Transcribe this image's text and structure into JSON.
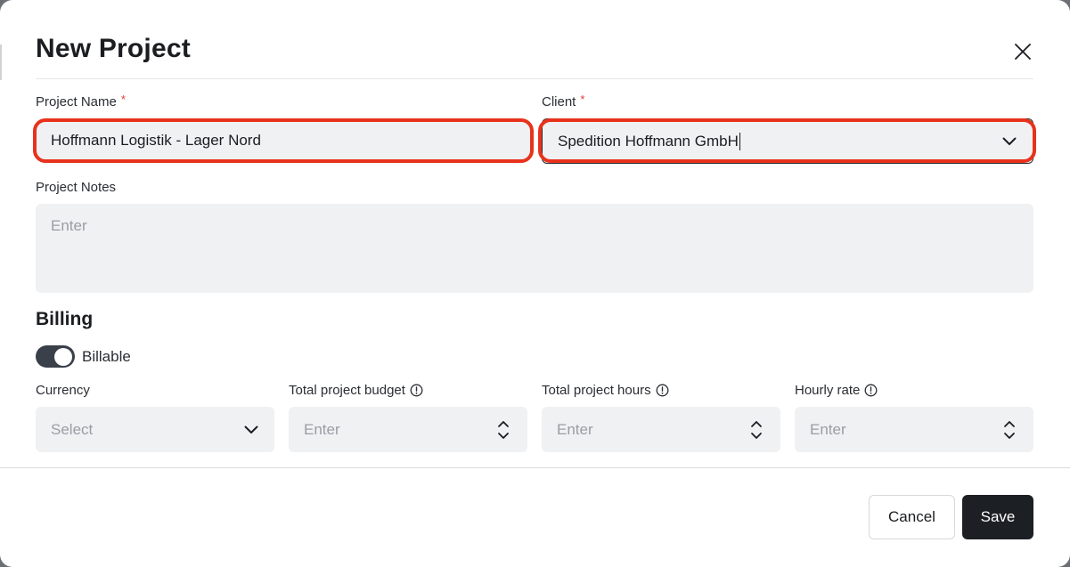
{
  "modal": {
    "title": "New Project"
  },
  "fields": {
    "project_name": {
      "label": "Project Name",
      "required_mark": "*",
      "value": "Hoffmann Logistik - Lager Nord"
    },
    "client": {
      "label": "Client",
      "required_mark": "*",
      "value": "Spedition Hoffmann GmbH"
    },
    "project_notes": {
      "label": "Project Notes",
      "placeholder": "Enter"
    }
  },
  "billing": {
    "section_title": "Billing",
    "billable_label": "Billable",
    "billable_on": true,
    "currency": {
      "label": "Currency",
      "placeholder": "Select"
    },
    "total_budget": {
      "label": "Total project budget",
      "placeholder": "Enter"
    },
    "total_hours": {
      "label": "Total project hours",
      "placeholder": "Enter"
    },
    "hourly_rate": {
      "label": "Hourly rate",
      "placeholder": "Enter"
    }
  },
  "footer": {
    "cancel_label": "Cancel",
    "save_label": "Save"
  },
  "colors": {
    "highlight": "#e8321c",
    "required": "#e03b3b",
    "primary_button": "#1c1f24",
    "field_bg": "#f0f1f3",
    "toggle_on": "#3a4049"
  },
  "icons": {
    "close": "close-icon",
    "dropdown": "chevron-down-icon",
    "stepper": "stepper-icon",
    "info": "info-icon"
  }
}
